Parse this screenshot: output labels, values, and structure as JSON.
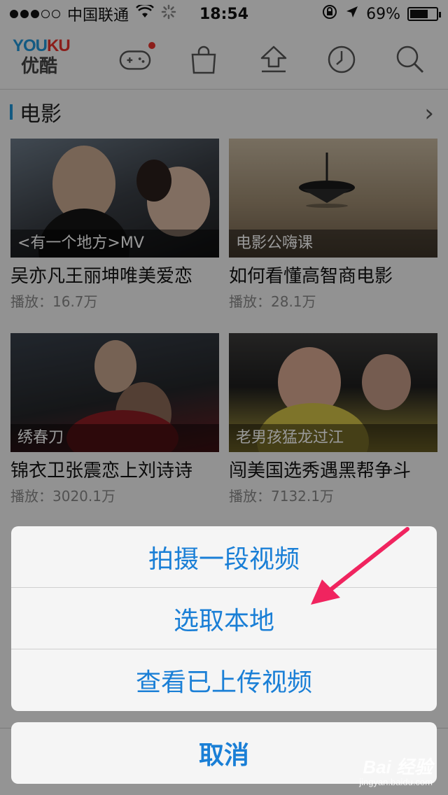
{
  "status_bar": {
    "carrier": "中国联通",
    "time": "18:54",
    "battery": "69%",
    "battery_level": 0.69
  },
  "header": {
    "logo_en_1": "YOU",
    "logo_en_2": "KU",
    "logo_cn": "优酷"
  },
  "section": {
    "title": "电影",
    "more": "›"
  },
  "videos": [
    {
      "caption": "<有一个地方>MV",
      "title": "吴亦凡王丽坤唯美爱恋",
      "plays": "播放：16.7万"
    },
    {
      "caption": "电影公嗨课",
      "title": "如何看懂高智商电影",
      "plays": "播放：28.1万"
    },
    {
      "caption": "绣春刀",
      "title": "锦衣卫张震恋上刘诗诗",
      "plays": "播放：3020.1万"
    },
    {
      "caption": "老男孩猛龙过江",
      "title": "闯美国选秀遇黑帮争斗",
      "plays": "播放：7132.1万"
    }
  ],
  "action_sheet": {
    "items": [
      "拍摄一段视频",
      "选取本地",
      "查看已上传视频"
    ],
    "cancel": "取消"
  },
  "watermark": {
    "main": "Bai 经验",
    "sub": "jingyan.baidu.com"
  },
  "colors": {
    "accent": "#1a7fd6",
    "brand_blue": "#2196d9",
    "brand_red": "#e8322c",
    "arrow": "#f0245f"
  }
}
